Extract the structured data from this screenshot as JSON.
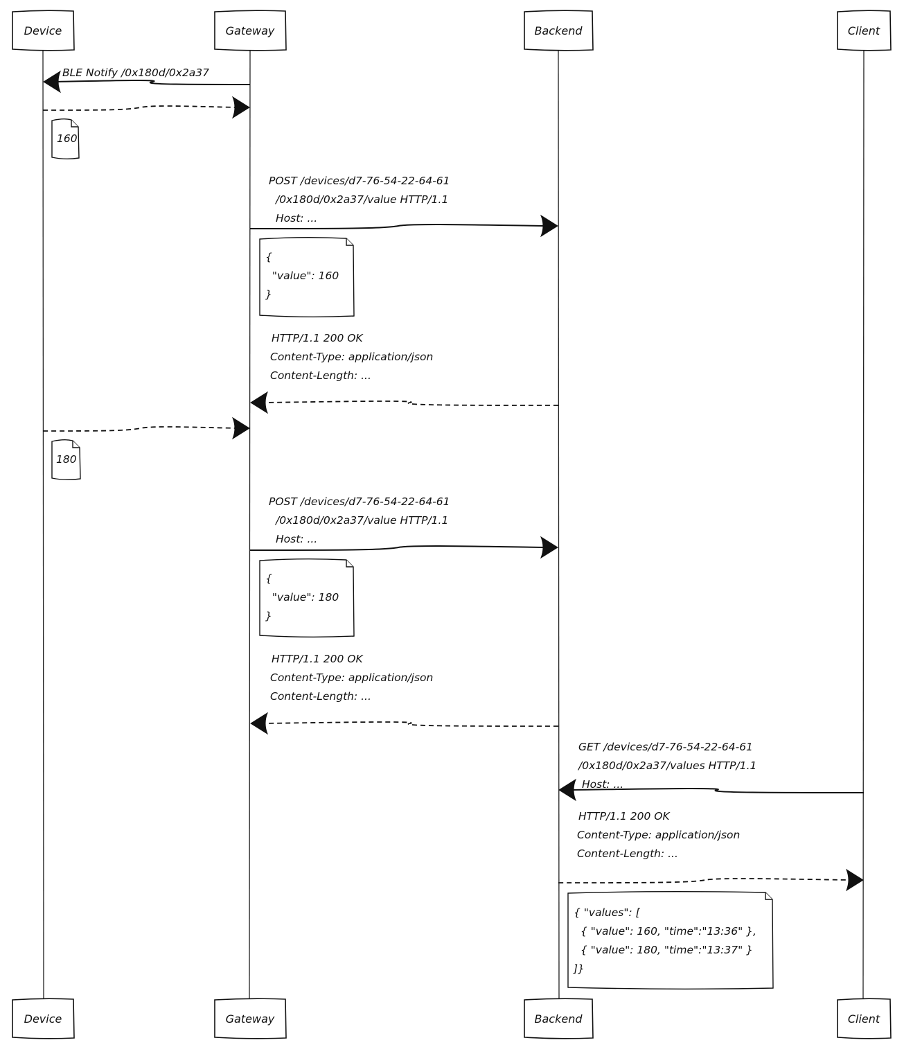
{
  "diagram": {
    "type": "sequence",
    "style": "hand-drawn",
    "actors": [
      {
        "id": "device",
        "label": "Device"
      },
      {
        "id": "gateway",
        "label": "Gateway"
      },
      {
        "id": "backend",
        "label": "Backend"
      },
      {
        "id": "client",
        "label": "Client"
      }
    ],
    "messages": [
      {
        "from": "gateway",
        "to": "device",
        "kind": "solid",
        "lines": [
          "BLE Notify /0x180d/0x2a37"
        ]
      },
      {
        "from": "device",
        "to": "gateway",
        "kind": "dashed",
        "lines": [],
        "note": [
          "160"
        ]
      },
      {
        "from": "gateway",
        "to": "backend",
        "kind": "solid",
        "lines": [
          "POST /devices/d7-76-54-22-64-61",
          "/0x180d/0x2a37/value HTTP/1.1",
          "Host: ..."
        ],
        "note": [
          "{",
          "  \"value\": 160",
          "}"
        ]
      },
      {
        "from": "backend",
        "to": "gateway",
        "kind": "dashed",
        "lines": [
          "HTTP/1.1 200 OK",
          "Content-Type: application/json",
          "Content-Length: ..."
        ]
      },
      {
        "from": "device",
        "to": "gateway",
        "kind": "dashed",
        "lines": [],
        "note": [
          "180"
        ]
      },
      {
        "from": "gateway",
        "to": "backend",
        "kind": "solid",
        "lines": [
          "POST /devices/d7-76-54-22-64-61",
          "/0x180d/0x2a37/value HTTP/1.1",
          "Host: ..."
        ],
        "note": [
          "{",
          "  \"value\": 180",
          "}"
        ]
      },
      {
        "from": "backend",
        "to": "gateway",
        "kind": "dashed",
        "lines": [
          "HTTP/1.1 200 OK",
          "Content-Type: application/json",
          "Content-Length: ..."
        ]
      },
      {
        "from": "client",
        "to": "backend",
        "kind": "solid",
        "lines": [
          "GET /devices/d7-76-54-22-64-61",
          "/0x180d/0x2a37/values HTTP/1.1",
          "Host: ..."
        ]
      },
      {
        "from": "backend",
        "to": "client",
        "kind": "dashed",
        "lines": [
          "HTTP/1.1 200 OK",
          "Content-Type: application/json",
          "Content-Length: ..."
        ],
        "note": [
          "{ \"values\": [",
          "  { \"value\": 160, \"time\":\"13:36\" },",
          "  { \"value\": 180, \"time\":\"13:37\" }",
          "]}"
        ]
      }
    ]
  }
}
